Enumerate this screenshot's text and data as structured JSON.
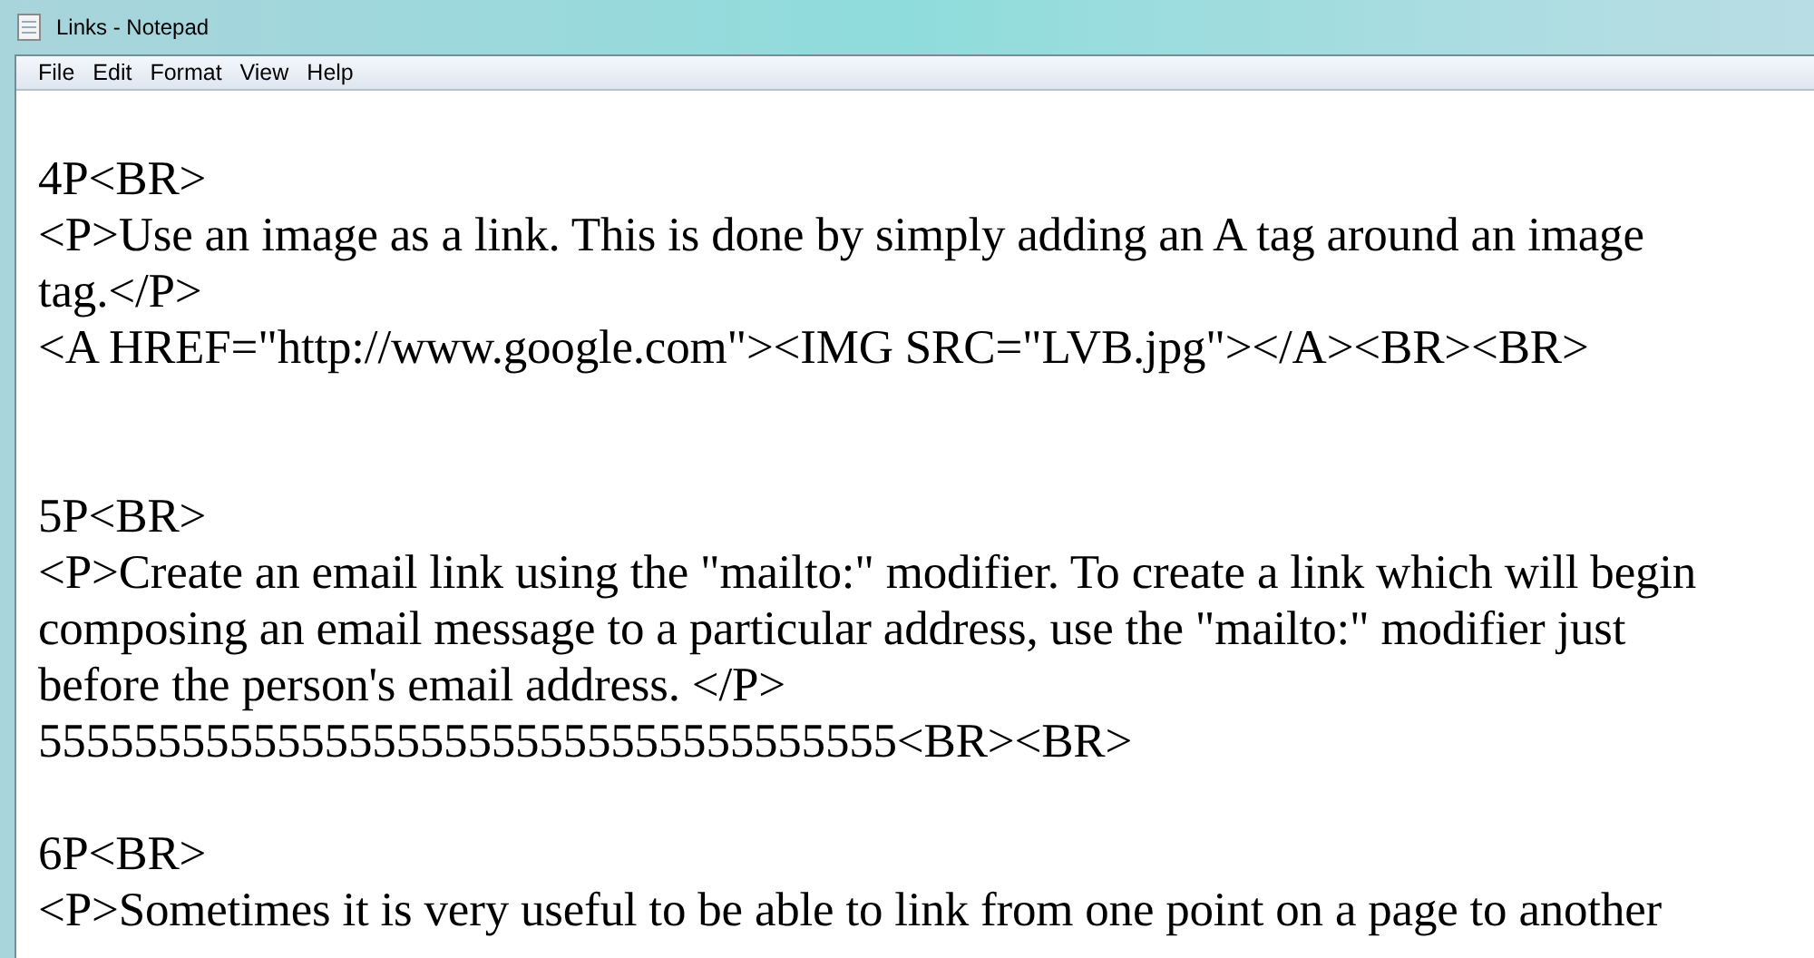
{
  "window": {
    "title": "Links - Notepad"
  },
  "menu": [
    "File",
    "Edit",
    "Format",
    "View",
    "Help"
  ],
  "lines": [
    {
      "kind": "blank"
    },
    {
      "kind": "text",
      "text": "4P<BR>"
    },
    {
      "kind": "text",
      "text": "<P>Use an image as a link. This is done by simply adding an A tag around an image"
    },
    {
      "kind": "text",
      "text": "tag.</P>"
    },
    {
      "kind": "text",
      "text": "<A HREF=\"http://www.google.com\"><IMG SRC=\"LVB.jpg\"></A><BR><BR>"
    },
    {
      "kind": "blank"
    },
    {
      "kind": "blank"
    },
    {
      "kind": "text",
      "text": "5P<BR>"
    },
    {
      "kind": "text",
      "text": "<P>Create an email link using the \"mailto:\" modifier. To create a link which will begin"
    },
    {
      "kind": "text",
      "text": "composing an email message to a particular address, use the \"mailto:\" modifier just"
    },
    {
      "kind": "text",
      "text": "before the person's email address. </P>"
    },
    {
      "kind": "text",
      "text": "555555555555555555555555555555555555<BR><BR>"
    },
    {
      "kind": "blank"
    },
    {
      "kind": "text",
      "text": "6P<BR>"
    },
    {
      "kind": "text",
      "text": "<P>Sometimes it is very useful to be able to link from one point on a page to another"
    }
  ]
}
